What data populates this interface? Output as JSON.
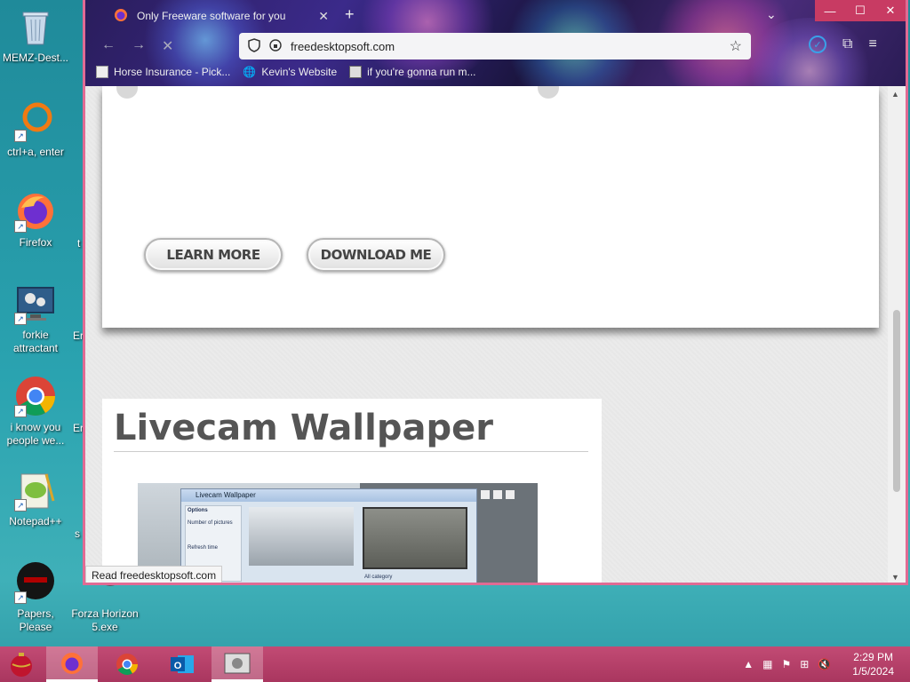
{
  "desktop": {
    "icons": [
      {
        "name": "recycle-bin",
        "label": "MEMZ-Dest..."
      },
      {
        "name": "ctrl-a-enter",
        "label": "ctrl+a, enter"
      },
      {
        "name": "firefox",
        "label": "Firefox"
      },
      {
        "name": "forkie-attractant",
        "label": "forkie attractant"
      },
      {
        "name": "chrome-shortcut",
        "label": "i know you people we..."
      },
      {
        "name": "notepadpp",
        "label": "Notepad++"
      },
      {
        "name": "papers-please",
        "label": "Papers, Please"
      },
      {
        "name": "forza-horizon",
        "label": "Forza Horizon 5.exe"
      }
    ],
    "cut_labels": [
      "t",
      "Er",
      "Er",
      "s"
    ]
  },
  "browser": {
    "tab_title": "Only Freeware software for you",
    "url": "freedesktopsoft.com",
    "bookmarks": [
      "Horse Insurance - Pick...",
      "Kevin's Website",
      "if you're gonna run m..."
    ],
    "status_text": "Read freedesktopsoft.com",
    "icons": {
      "back": "back-arrow-icon",
      "forward": "forward-arrow-icon",
      "reload": "reload-icon"
    }
  },
  "page": {
    "learn_more": "LEARN MORE",
    "download_me": "DOWNLOAD ME",
    "section_title": "Livecam Wallpaper",
    "preview_app_title": "Livecam Wallpaper",
    "preview_side_options": "Options",
    "preview_side_count": "Number of pictures",
    "preview_side_refresh": "Refresh time",
    "preview_category": "All category"
  },
  "taskbar": {
    "time": "2:29 PM",
    "date": "1/5/2024"
  },
  "colors": {
    "window_border": "#e06b94",
    "taskbar": "#b83e68",
    "desktop": "#2aa3b0"
  }
}
